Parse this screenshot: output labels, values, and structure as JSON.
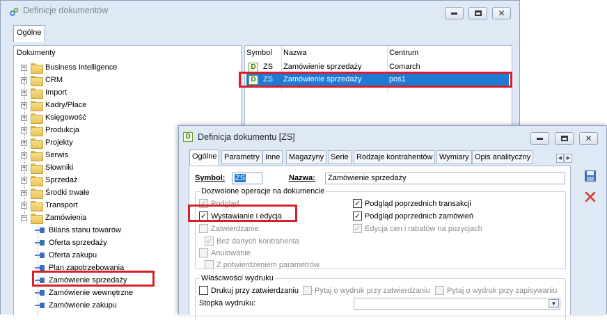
{
  "back_window": {
    "title": "Definicje dokumentów",
    "tabs": [
      "Ogólne"
    ],
    "tree": {
      "header": "Dokumenty",
      "items": [
        {
          "label": "Business Intelligence",
          "type": "folder",
          "expander": "+",
          "level": 0
        },
        {
          "label": "CRM",
          "type": "folder",
          "expander": "+",
          "level": 0
        },
        {
          "label": "Import",
          "type": "folder",
          "expander": "+",
          "level": 0
        },
        {
          "label": "Kadry/Płace",
          "type": "folder",
          "expander": "+",
          "level": 0
        },
        {
          "label": "Księgowość",
          "type": "folder",
          "expander": "+",
          "level": 0
        },
        {
          "label": "Produkcja",
          "type": "folder",
          "expander": "+",
          "level": 0
        },
        {
          "label": "Projekty",
          "type": "folder",
          "expander": "+",
          "level": 0
        },
        {
          "label": "Serwis",
          "type": "folder",
          "expander": "+",
          "level": 0
        },
        {
          "label": "Słowniki",
          "type": "folder",
          "expander": "+",
          "level": 0
        },
        {
          "label": "Sprzedaż",
          "type": "folder",
          "expander": "+",
          "level": 0
        },
        {
          "label": "Środki trwałe",
          "type": "folder",
          "expander": "+",
          "level": 0
        },
        {
          "label": "Transport",
          "type": "folder",
          "expander": "+",
          "level": 0
        },
        {
          "label": "Zamówienia",
          "type": "folder",
          "expander": "−",
          "level": 0
        },
        {
          "label": "Bilans stanu towarów",
          "type": "doc",
          "level": 1
        },
        {
          "label": "Oferta sprzedaży",
          "type": "doc",
          "level": 1
        },
        {
          "label": "Oferta zakupu",
          "type": "doc",
          "level": 1
        },
        {
          "label": "Plan zapotrzebowania",
          "type": "doc",
          "level": 1
        },
        {
          "label": "Zamówienie sprzedaży",
          "type": "doc",
          "level": 1
        },
        {
          "label": "Zamówienie wewnętrzne",
          "type": "doc",
          "level": 1
        },
        {
          "label": "Zamówienie zakupu",
          "type": "doc",
          "level": 1
        }
      ]
    },
    "list": {
      "columns": [
        "Symbol",
        "Nazwa",
        "Centrum"
      ],
      "rows": [
        {
          "icon": "D",
          "symbol": "ZS",
          "nazwa": "Zamówienie sprzedaży",
          "centrum": "Comarch"
        },
        {
          "icon": "D",
          "symbol": "ZS",
          "nazwa": "Zamówienie sprzedaży",
          "centrum": "pos1"
        }
      ]
    }
  },
  "dialog": {
    "title": "Definicja dokumentu [ZS]",
    "icon": "D",
    "tabs": [
      "Ogólne",
      "Parametry",
      "Inne",
      "Magazyny",
      "Serie",
      "Rodzaje kontrahentów",
      "Wymiary",
      "Opis analityczny"
    ],
    "symbol_label": "Symbol:",
    "symbol_value": "ZS",
    "nazwa_label": "Nazwa:",
    "nazwa_value": "Zamówienie sprzedaży",
    "ops_group": {
      "title": "Dozwolone operacje na dokumencie",
      "left": [
        {
          "label": "Podgląd",
          "checked": true,
          "enabled": false
        },
        {
          "label": "Wystawianie i edycja",
          "checked": true,
          "enabled": true
        },
        {
          "label": "Zatwierdzanie",
          "checked": false,
          "enabled": false
        },
        {
          "label": "Bez danych kontrahenta",
          "checked": true,
          "enabled": false
        },
        {
          "label": "Anulowanie",
          "checked": false,
          "enabled": false
        },
        {
          "label": "Z potwierdzeniem parametrów",
          "checked": false,
          "enabled": false
        }
      ],
      "right": [
        {
          "label": "Podgląd poprzednich transakcji",
          "checked": true,
          "enabled": true
        },
        {
          "label": "Podgląd poprzednich zamówień",
          "checked": true,
          "enabled": true
        },
        {
          "label": "Edycja cen i rabatów na pozycjach",
          "checked": true,
          "enabled": false
        }
      ]
    },
    "print_group": {
      "title": "Właściwości wydruku",
      "checkboxes": [
        {
          "label": "Drukuj przy zatwierdzaniu",
          "checked": false,
          "enabled": true
        },
        {
          "label": "Pytaj o wydruk przy zatwierdzaniu",
          "checked": false,
          "enabled": false
        },
        {
          "label": "Pytaj o wydruk przy zapisywaniu",
          "checked": false,
          "enabled": false
        }
      ],
      "footer_label": "Stopka wydruku:",
      "footer_value": ""
    }
  },
  "colors": {
    "selection": "#1f7ad6",
    "highlight_box": "#d5202a",
    "window_bg": "#dfe9f5"
  }
}
